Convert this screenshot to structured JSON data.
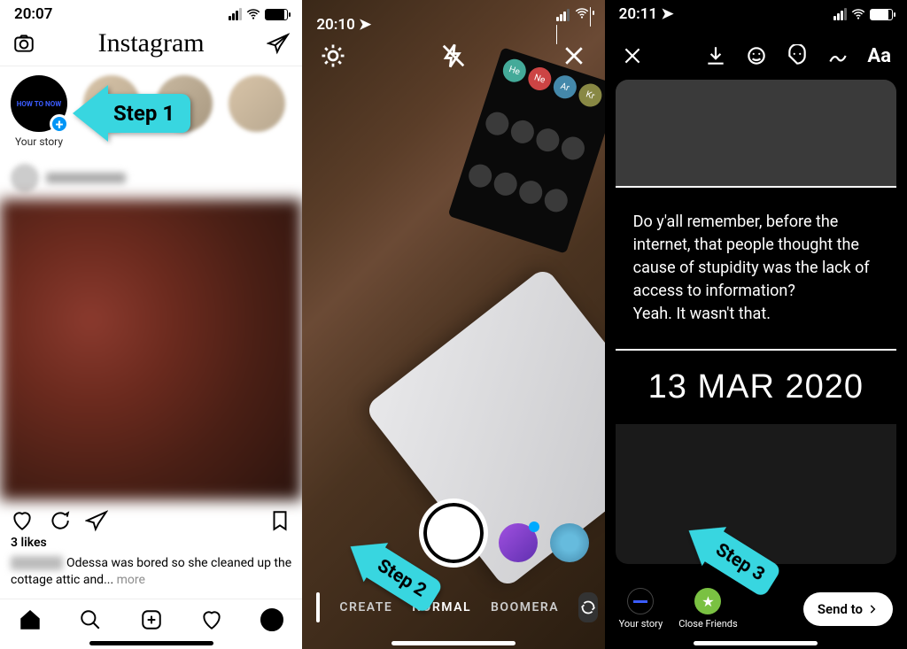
{
  "steps": {
    "s1": "Step 1",
    "s2": "Step 2",
    "s3": "Step 3"
  },
  "screen1": {
    "time": "20:07",
    "logo": "Instagram",
    "your_story": "Your story",
    "avatar_text": "HOW TO NOW",
    "likes": "3 likes",
    "caption": "Odessa was bored so she cleaned up the cottage attic and... ",
    "more": "more"
  },
  "screen2": {
    "time": "20:10",
    "modes": {
      "create": "CREATE",
      "normal": "NORMAL",
      "boomerang": "BOOMERA"
    },
    "sticker_labels": [
      "He",
      "Ne",
      "Ar",
      "Kr"
    ]
  },
  "screen3": {
    "time": "20:11",
    "text_tool": "Aa",
    "body": "Do y'all remember, before the internet, that people thought the cause of stupidity was the lack of access to information?\nYeah.  It wasn't that.",
    "date": "13 MAR 2020",
    "your_story": "Your story",
    "close_friends": "Close Friends",
    "send_to": "Send to"
  }
}
